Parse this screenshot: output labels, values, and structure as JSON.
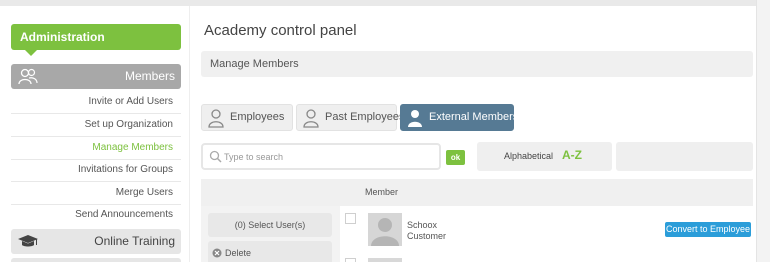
{
  "sidebar": {
    "admin_label": "Administration",
    "members_label": "Members",
    "members_items": [
      {
        "label": "Invite or Add Users"
      },
      {
        "label": "Set up Organization"
      },
      {
        "label": "Manage Members",
        "active": true
      },
      {
        "label": "Invitations for Groups"
      },
      {
        "label": "Merge Users"
      },
      {
        "label": "Send Announcements"
      }
    ],
    "training_label": "Online Training"
  },
  "main": {
    "title": "Academy control panel",
    "section_title": "Manage Members",
    "tabs": [
      {
        "label": "Employees",
        "icon": "person-icon",
        "selected": false
      },
      {
        "label": "Past Employees",
        "icon": "person-icon",
        "selected": false
      },
      {
        "label": "External Members",
        "icon": "person-icon",
        "selected": true
      }
    ],
    "search": {
      "placeholder": "Type to search",
      "value": "",
      "ok_label": "ok"
    },
    "sort": {
      "label": "Alphabetical",
      "az_label_a": "A",
      "az_dash": "-",
      "az_label_z": "Z"
    },
    "table": {
      "member_header": "Member",
      "select_users_label": "(0) Select User(s)",
      "delete_label": "Delete",
      "rows": [
        {
          "name": "Schoox",
          "role": "Customer",
          "action": "Convert to Employee"
        }
      ]
    }
  },
  "colors": {
    "accent_green": "#7dc13f",
    "selected_tab": "#567a94",
    "action_blue": "#2b9dd9",
    "section_gray": "#a8a8a8"
  }
}
